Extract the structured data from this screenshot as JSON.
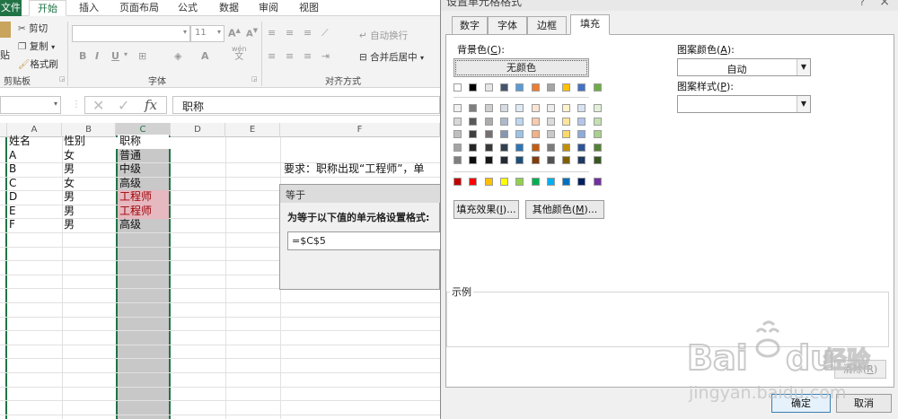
{
  "excel": {
    "ribbon_tabs": [
      "文件",
      "开始",
      "插入",
      "页面布局",
      "公式",
      "数据",
      "审阅",
      "视图"
    ],
    "clipboard": {
      "paste": "贴",
      "cut": "剪切",
      "copy": "复制",
      "format_painter": "格式刷",
      "group": "剪贴板"
    },
    "font": {
      "size": "11",
      "group": "字体",
      "bold": "B",
      "italic": "I",
      "underline": "U",
      "font_size_up": "A",
      "font_size_down": "A",
      "wen": "wén",
      "wen_char": "文"
    },
    "alignment": {
      "wrap_text": "自动换行",
      "merge_center": "合并后居中",
      "group": "对齐方式"
    },
    "formula_bar": {
      "fx": "fx",
      "value": "职称"
    },
    "columns": [
      "A",
      "B",
      "C",
      "D",
      "E",
      "F"
    ],
    "rows": [
      {
        "a": "姓名",
        "b": "性别",
        "c": "职称"
      },
      {
        "a": "A",
        "b": "女",
        "c": "普通"
      },
      {
        "a": "B",
        "b": "男",
        "c": "中级"
      },
      {
        "a": "C",
        "b": "女",
        "c": "高级"
      },
      {
        "a": "D",
        "b": "男",
        "c": "工程师"
      },
      {
        "a": "E",
        "b": "男",
        "c": "工程师"
      },
      {
        "a": "F",
        "b": "男",
        "c": "高级"
      }
    ],
    "requirement_text": "要求：职称出现“工程师”，单",
    "equal_dialog": {
      "title": "等于",
      "label": "为等于以下值的单元格设置格式:",
      "value": "=$C$5"
    }
  },
  "format_cells": {
    "title": "设置单元格格式",
    "tabs": [
      "数字",
      "字体",
      "边框",
      "填充"
    ],
    "active_tab": "填充",
    "background_color_label": "背景色",
    "background_color_key": "C",
    "no_color": "无颜色",
    "fill_effects": "填充效果",
    "fill_effects_key": "I",
    "more_colors": "其他颜色",
    "more_colors_key": "M",
    "pattern_color_label": "图案颜色",
    "pattern_color_key": "A",
    "pattern_color_value": "自动",
    "pattern_style_label": "图案样式",
    "pattern_style_key": "P",
    "pattern_style_value": "",
    "sample_label": "示例",
    "clear": "清除",
    "clear_key": "R",
    "ok": "确定",
    "cancel": "取消",
    "palette_top": [
      "#ffffff",
      "#000000",
      "#e7e6e6",
      "#44546a",
      "#5b9bd5",
      "#ed7d31",
      "#a5a5a5",
      "#ffc000",
      "#4472c4",
      "#70ad47"
    ],
    "palette_grid": [
      [
        "#f2f2f2",
        "#7f7f7f",
        "#d0cece",
        "#d6dce4",
        "#deebf6",
        "#fbe5d5",
        "#ededed",
        "#fff2cc",
        "#d9e2f3",
        "#e2efd9"
      ],
      [
        "#d8d8d8",
        "#595959",
        "#aeabab",
        "#adb9ca",
        "#bdd7ee",
        "#f7cbac",
        "#dbdbdb",
        "#fee599",
        "#b4c6e7",
        "#c5e0b3"
      ],
      [
        "#bfbfbf",
        "#3f3f3f",
        "#757070",
        "#8496b0",
        "#9cc3e5",
        "#f4b183",
        "#c9c9c9",
        "#ffd965",
        "#8eaadb",
        "#a8d08d"
      ],
      [
        "#a5a5a5",
        "#262626",
        "#3a3838",
        "#323f4f",
        "#2e75b5",
        "#c55a11",
        "#7b7b7b",
        "#bf9000",
        "#2f5496",
        "#538135"
      ],
      [
        "#7f7f7f",
        "#0c0c0c",
        "#171616",
        "#222a35",
        "#1e4e79",
        "#833c0b",
        "#525252",
        "#7f6000",
        "#1f3864",
        "#375623"
      ]
    ],
    "palette_standard": [
      "#c00000",
      "#ff0000",
      "#ffc000",
      "#ffff00",
      "#92d050",
      "#00b050",
      "#00b0f0",
      "#0070c0",
      "#002060",
      "#7030a0"
    ]
  },
  "watermark": {
    "brand": "Bai",
    "brand_tail": "du",
    "brand_cn": "经验",
    "url": "jingyan.baidu.com"
  }
}
